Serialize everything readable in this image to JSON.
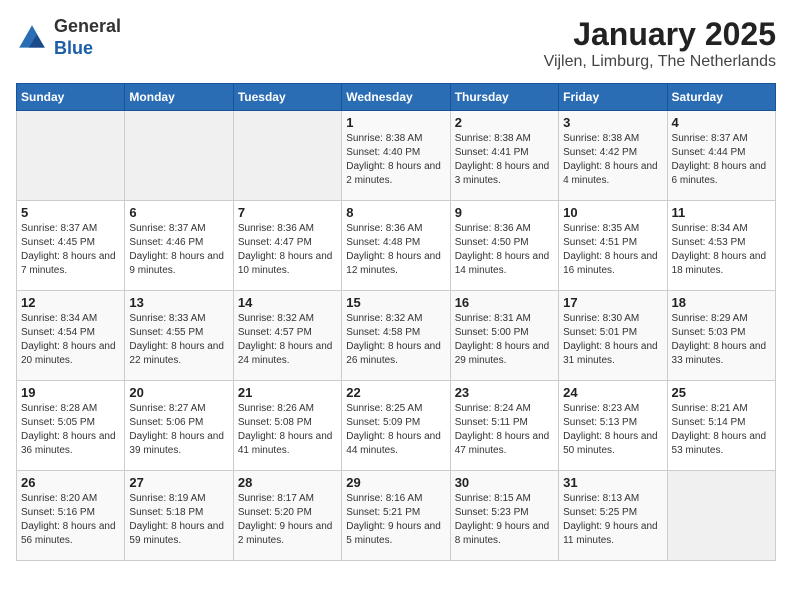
{
  "header": {
    "logo_line1": "General",
    "logo_line2": "Blue",
    "month": "January 2025",
    "location": "Vijlen, Limburg, The Netherlands"
  },
  "weekdays": [
    "Sunday",
    "Monday",
    "Tuesday",
    "Wednesday",
    "Thursday",
    "Friday",
    "Saturday"
  ],
  "weeks": [
    [
      {
        "day": "",
        "info": ""
      },
      {
        "day": "",
        "info": ""
      },
      {
        "day": "",
        "info": ""
      },
      {
        "day": "1",
        "info": "Sunrise: 8:38 AM\nSunset: 4:40 PM\nDaylight: 8 hours and 2 minutes."
      },
      {
        "day": "2",
        "info": "Sunrise: 8:38 AM\nSunset: 4:41 PM\nDaylight: 8 hours and 3 minutes."
      },
      {
        "day": "3",
        "info": "Sunrise: 8:38 AM\nSunset: 4:42 PM\nDaylight: 8 hours and 4 minutes."
      },
      {
        "day": "4",
        "info": "Sunrise: 8:37 AM\nSunset: 4:44 PM\nDaylight: 8 hours and 6 minutes."
      }
    ],
    [
      {
        "day": "5",
        "info": "Sunrise: 8:37 AM\nSunset: 4:45 PM\nDaylight: 8 hours and 7 minutes."
      },
      {
        "day": "6",
        "info": "Sunrise: 8:37 AM\nSunset: 4:46 PM\nDaylight: 8 hours and 9 minutes."
      },
      {
        "day": "7",
        "info": "Sunrise: 8:36 AM\nSunset: 4:47 PM\nDaylight: 8 hours and 10 minutes."
      },
      {
        "day": "8",
        "info": "Sunrise: 8:36 AM\nSunset: 4:48 PM\nDaylight: 8 hours and 12 minutes."
      },
      {
        "day": "9",
        "info": "Sunrise: 8:36 AM\nSunset: 4:50 PM\nDaylight: 8 hours and 14 minutes."
      },
      {
        "day": "10",
        "info": "Sunrise: 8:35 AM\nSunset: 4:51 PM\nDaylight: 8 hours and 16 minutes."
      },
      {
        "day": "11",
        "info": "Sunrise: 8:34 AM\nSunset: 4:53 PM\nDaylight: 8 hours and 18 minutes."
      }
    ],
    [
      {
        "day": "12",
        "info": "Sunrise: 8:34 AM\nSunset: 4:54 PM\nDaylight: 8 hours and 20 minutes."
      },
      {
        "day": "13",
        "info": "Sunrise: 8:33 AM\nSunset: 4:55 PM\nDaylight: 8 hours and 22 minutes."
      },
      {
        "day": "14",
        "info": "Sunrise: 8:32 AM\nSunset: 4:57 PM\nDaylight: 8 hours and 24 minutes."
      },
      {
        "day": "15",
        "info": "Sunrise: 8:32 AM\nSunset: 4:58 PM\nDaylight: 8 hours and 26 minutes."
      },
      {
        "day": "16",
        "info": "Sunrise: 8:31 AM\nSunset: 5:00 PM\nDaylight: 8 hours and 29 minutes."
      },
      {
        "day": "17",
        "info": "Sunrise: 8:30 AM\nSunset: 5:01 PM\nDaylight: 8 hours and 31 minutes."
      },
      {
        "day": "18",
        "info": "Sunrise: 8:29 AM\nSunset: 5:03 PM\nDaylight: 8 hours and 33 minutes."
      }
    ],
    [
      {
        "day": "19",
        "info": "Sunrise: 8:28 AM\nSunset: 5:05 PM\nDaylight: 8 hours and 36 minutes."
      },
      {
        "day": "20",
        "info": "Sunrise: 8:27 AM\nSunset: 5:06 PM\nDaylight: 8 hours and 39 minutes."
      },
      {
        "day": "21",
        "info": "Sunrise: 8:26 AM\nSunset: 5:08 PM\nDaylight: 8 hours and 41 minutes."
      },
      {
        "day": "22",
        "info": "Sunrise: 8:25 AM\nSunset: 5:09 PM\nDaylight: 8 hours and 44 minutes."
      },
      {
        "day": "23",
        "info": "Sunrise: 8:24 AM\nSunset: 5:11 PM\nDaylight: 8 hours and 47 minutes."
      },
      {
        "day": "24",
        "info": "Sunrise: 8:23 AM\nSunset: 5:13 PM\nDaylight: 8 hours and 50 minutes."
      },
      {
        "day": "25",
        "info": "Sunrise: 8:21 AM\nSunset: 5:14 PM\nDaylight: 8 hours and 53 minutes."
      }
    ],
    [
      {
        "day": "26",
        "info": "Sunrise: 8:20 AM\nSunset: 5:16 PM\nDaylight: 8 hours and 56 minutes."
      },
      {
        "day": "27",
        "info": "Sunrise: 8:19 AM\nSunset: 5:18 PM\nDaylight: 8 hours and 59 minutes."
      },
      {
        "day": "28",
        "info": "Sunrise: 8:17 AM\nSunset: 5:20 PM\nDaylight: 9 hours and 2 minutes."
      },
      {
        "day": "29",
        "info": "Sunrise: 8:16 AM\nSunset: 5:21 PM\nDaylight: 9 hours and 5 minutes."
      },
      {
        "day": "30",
        "info": "Sunrise: 8:15 AM\nSunset: 5:23 PM\nDaylight: 9 hours and 8 minutes."
      },
      {
        "day": "31",
        "info": "Sunrise: 8:13 AM\nSunset: 5:25 PM\nDaylight: 9 hours and 11 minutes."
      },
      {
        "day": "",
        "info": ""
      }
    ]
  ]
}
